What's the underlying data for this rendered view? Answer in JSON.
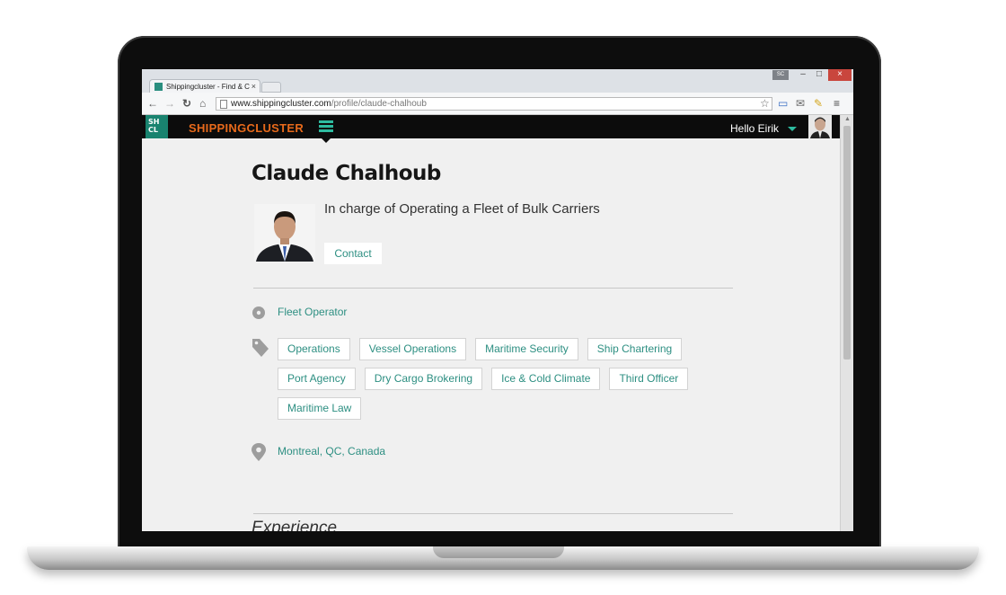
{
  "browser": {
    "tab_title": "Shippingcluster - Find & C",
    "tab_close": "×",
    "url_domain": "www.shippingcluster.com",
    "url_path": "/profile/claude-chalhoub",
    "user_badge": "SC",
    "minimize": "–",
    "maximize": "□",
    "close": "×"
  },
  "site": {
    "logo_line1": "SH",
    "logo_line2": "CL",
    "brand": "SHIPPINGCLUSTER",
    "greeting": "Hello Eirik"
  },
  "profile": {
    "name": "Claude Chalhoub",
    "headline": "In charge of Operating a Fleet of Bulk Carriers",
    "contact_label": "Contact",
    "role": "Fleet Operator",
    "tags": [
      "Operations",
      "Vessel Operations",
      "Maritime Security",
      "Ship Chartering",
      "Port Agency",
      "Dry Cargo Brokering",
      "Ice & Cold Climate",
      "Third Officer",
      "Maritime Law"
    ],
    "location": "Montreal, QC, Canada",
    "experience_title": "Experience"
  }
}
